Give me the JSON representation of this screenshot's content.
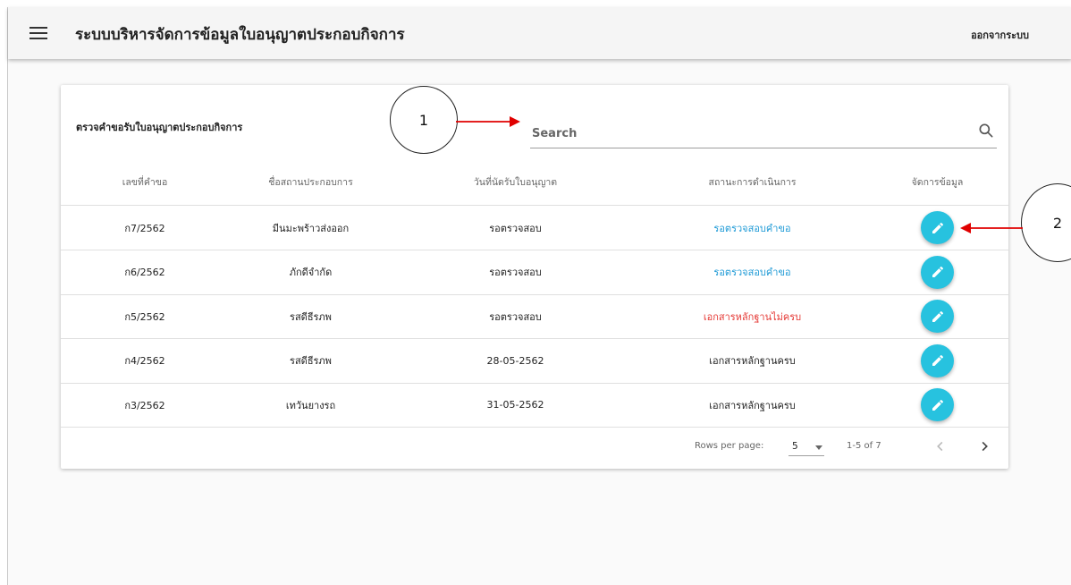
{
  "topbar": {
    "title": "ระบบบริหารจัดการข้อมูลใบอนุญาตประกอบกิจการ",
    "logout_label": "ออกจากระบบ"
  },
  "card": {
    "title": "ตรวจคำขอรับใบอนุญาตประกอบกิจการ",
    "search": {
      "placeholder": "Search"
    },
    "columns": [
      "เลขที่คำขอ",
      "ชื่อสถานประกอบการ",
      "วันที่นัดรับใบอนุญาต",
      "สถานะการดำเนินการ",
      "จัดการข้อมูล"
    ],
    "rows": [
      {
        "request_no": "ก7/2562",
        "business": "มีนมะพร้าวส่งออก",
        "date": "รอตรวจสอบ",
        "status": "รอตรวจสอบคำขอ",
        "status_color": "#1e9ad6"
      },
      {
        "request_no": "ก6/2562",
        "business": "ภักดีจำกัด",
        "date": "รอตรวจสอบ",
        "status": "รอตรวจสอบคำขอ",
        "status_color": "#1e9ad6"
      },
      {
        "request_no": "ก5/2562",
        "business": "รสดีธีรภพ",
        "date": "รอตรวจสอบ",
        "status": "เอกสารหลักฐานไม่ครบ",
        "status_color": "#e53935"
      },
      {
        "request_no": "ก4/2562",
        "business": "รสดีธีรภพ",
        "date": "28-05-2562",
        "status": "เอกสารหลักฐานครบ",
        "status_color": "#222222"
      },
      {
        "request_no": "ก3/2562",
        "business": "เทวันยางรถ",
        "date": "31-05-2562",
        "status": "เอกสารหลักฐานครบ",
        "status_color": "#222222"
      }
    ],
    "footer": {
      "rows_per_page_label": "Rows per page:",
      "rows_per_page_value": "5",
      "range": "1-5 of 7"
    }
  },
  "annotations": {
    "one": "1",
    "two": "2"
  },
  "colors": {
    "accent": "#27c2df",
    "annotation_arrow": "#e00000"
  },
  "icons": [
    "menu-icon",
    "search-icon",
    "pencil-icon",
    "chevron-left-icon",
    "chevron-right-icon",
    "caret-down-icon"
  ]
}
